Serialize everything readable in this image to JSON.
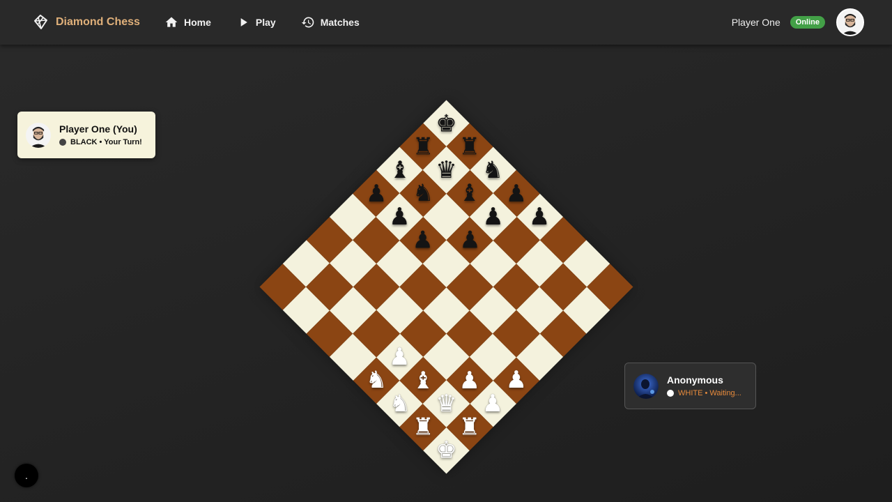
{
  "nav": {
    "brand": "Diamond Chess",
    "links": [
      {
        "label": "Home",
        "icon": "home-icon"
      },
      {
        "label": "Play",
        "icon": "play-icon"
      },
      {
        "label": "Matches",
        "icon": "history-icon"
      }
    ],
    "username": "Player One",
    "status": "Online"
  },
  "players": {
    "me": {
      "name": "Player One (You)",
      "status": "BLACK • Your Turn!"
    },
    "opponent": {
      "name": "Anonymous",
      "status": "WHITE • Waiting..."
    }
  },
  "board": {
    "rows": [
      [
        "bk",
        "br",
        "bn",
        "bp",
        "bp",
        "",
        "",
        ""
      ],
      [
        "br",
        "bq",
        "bb",
        "bp",
        "",
        "",
        "",
        ""
      ],
      [
        "bb",
        "bn",
        "",
        "bp",
        "",
        "",
        "",
        ""
      ],
      [
        "bp",
        "bp",
        "bp",
        "",
        "",
        "",
        "",
        ""
      ],
      [
        "",
        "",
        "",
        "",
        "",
        "",
        "",
        "wp"
      ],
      [
        "",
        "",
        "",
        "",
        "",
        "",
        "wp",
        "wp"
      ],
      [
        "",
        "",
        "",
        "",
        "wp",
        "wb",
        "wq",
        "wr"
      ],
      [
        "",
        "",
        "",
        "",
        "wn",
        "wn",
        "wr",
        "wk"
      ]
    ],
    "colors": {
      "light": "#f4f2dd",
      "dark": "#8b4513"
    }
  },
  "fab": {
    "label": "."
  },
  "colors": {
    "accent": "#e0b07a",
    "online": "#43a047",
    "waiting": "#e68a3c"
  }
}
